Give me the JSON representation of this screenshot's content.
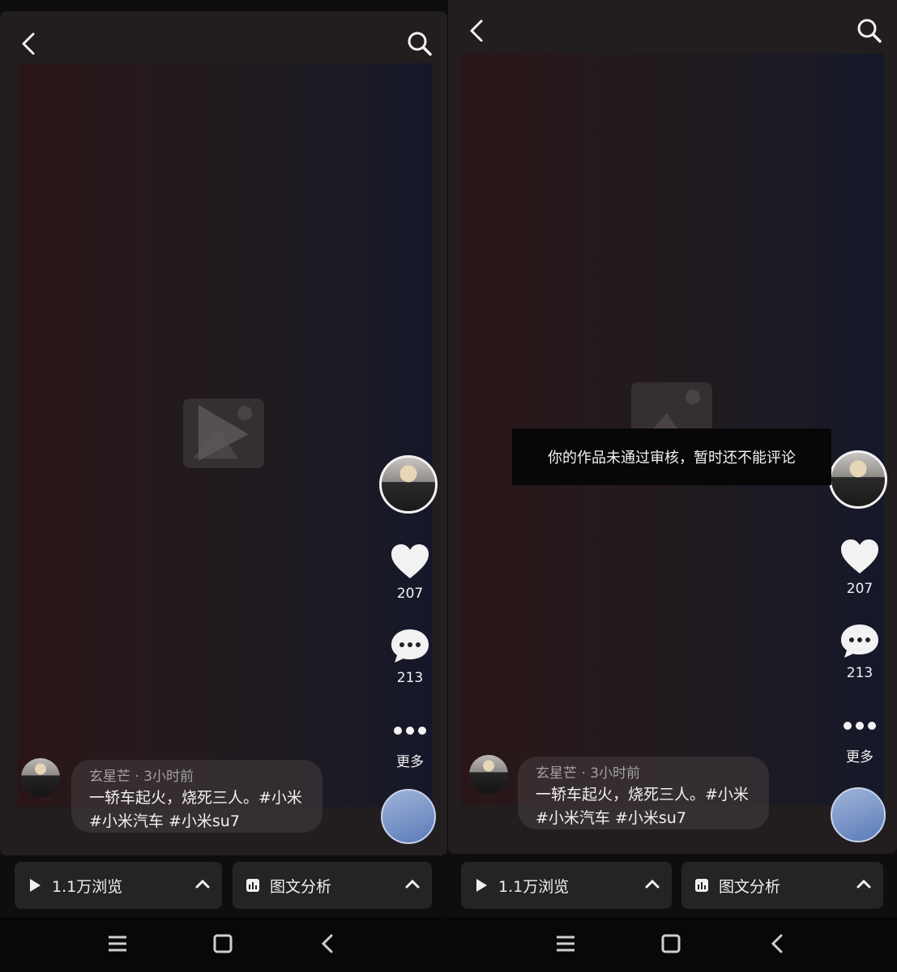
{
  "panels": [
    {
      "author": "玄星芒",
      "time": "3小时前",
      "description": "一轿车起火，烧死三人。#小米 #小米汽车 #小米su7",
      "likes": "207",
      "comments": "213",
      "more_label": "更多",
      "views": "1.1万浏览",
      "analysis": "图文分析",
      "toast": ""
    },
    {
      "author": "玄星芒",
      "time": "3小时前",
      "description": "一轿车起火，烧死三人。#小米 #小米汽车 #小米su7",
      "likes": "207",
      "comments": "213",
      "more_label": "更多",
      "views": "1.1万浏览",
      "analysis": "图文分析",
      "toast": "你的作品未通过审核，暂时还不能评论"
    }
  ],
  "icons": [
    "back-icon",
    "search-icon",
    "play-icon",
    "heart-icon",
    "comment-icon",
    "more-icon",
    "chevron-up-icon",
    "chart-icon",
    "menu-icon",
    "home-icon"
  ]
}
